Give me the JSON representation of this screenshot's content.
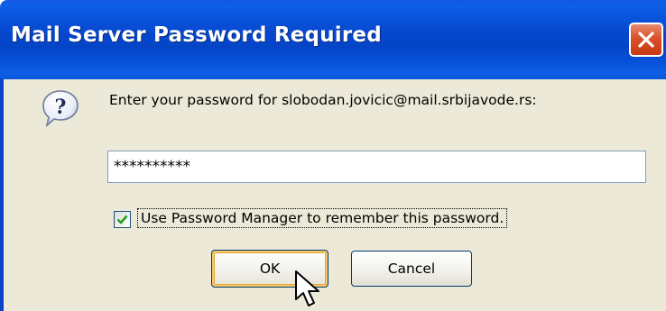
{
  "dialog": {
    "title": "Mail Server Password Required",
    "prompt": "Enter your password for slobodan.jovicic@mail.srbijavode.rs:",
    "password_value": "**********",
    "remember_checkbox": {
      "label": "Use Password Manager to remember this password.",
      "checked": true
    },
    "buttons": {
      "ok_label": "OK",
      "cancel_label": "Cancel"
    },
    "icons": {
      "title_close": "close-icon",
      "prompt": "question-icon",
      "pointer": "mouse-cursor-icon"
    }
  },
  "colors": {
    "titlebar": "#0646cc",
    "close_button": "#d9512b",
    "dialog_background": "#ece9d8",
    "input_border": "#7f9db9",
    "checkmark": "#21a121",
    "default_button_highlight": "#f6c865"
  }
}
